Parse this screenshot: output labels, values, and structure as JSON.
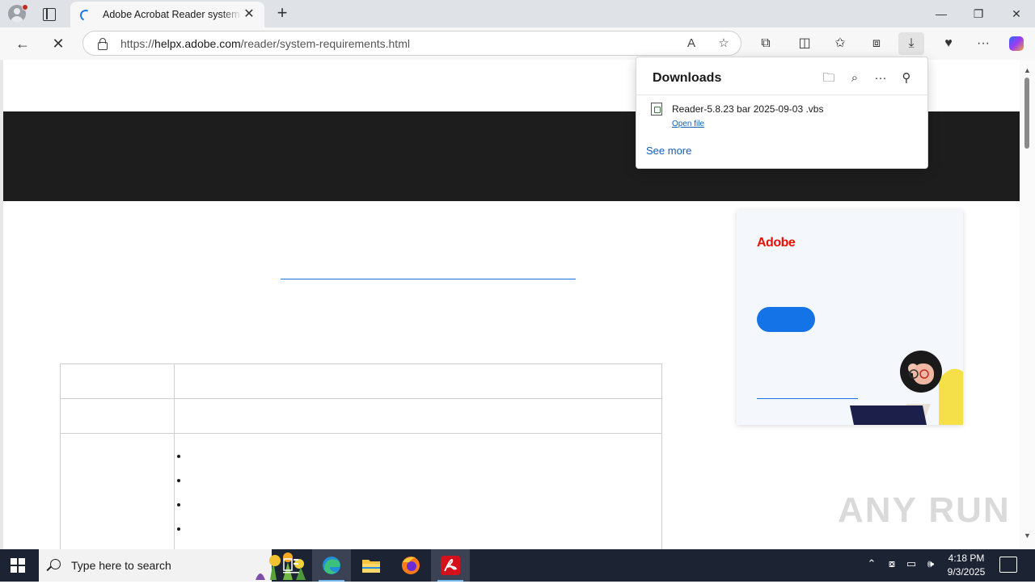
{
  "browser": {
    "tab": {
      "title": "Adobe Acrobat Reader system requirements"
    },
    "address": {
      "url_prefix": "https://",
      "url_domain": "helpx.adobe.com",
      "url_path": "/reader/system-requirements.html"
    },
    "window_controls": {
      "minimize": "—",
      "restore": "❐",
      "close": "✕"
    },
    "new_tab_label": "+",
    "tab_close_label": "✕"
  },
  "downloads": {
    "title": "Downloads",
    "items": [
      {
        "file_name": "Reader-5.8.23 bar 2025-09-03 .vbs",
        "action": "Open file"
      }
    ],
    "see_more": "See more"
  },
  "ad": {
    "brand": "Adobe",
    "accent_color": "#1473e6",
    "brand_color": "#eb1000"
  },
  "taskbar": {
    "search_placeholder": "Type here to search",
    "time": "4:18 PM",
    "date": "9/3/2025"
  },
  "watermark": "ANY RUN",
  "icons": {
    "back": "←",
    "reload": "✕",
    "read_aloud": "A",
    "favorite": "☆",
    "extensions": "⧉",
    "split": "◫",
    "favorites": "✩",
    "collections": "⧈",
    "download": "⤓",
    "more": "···",
    "folder": "🗀",
    "search": "⌕",
    "pin": "⚲",
    "chevron_up": "⌃",
    "speaker": "🕪"
  }
}
